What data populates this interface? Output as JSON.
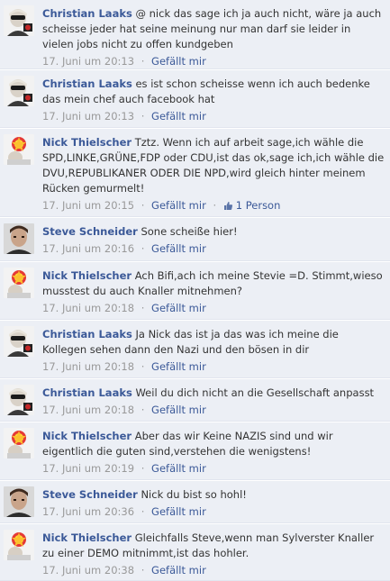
{
  "comments": [
    {
      "author": "Christian Laaks",
      "avatar": "christian-avatar",
      "text": "@ nick das sage ich ja auch nicht, wäre ja auch scheisse jeder hat seine meinung nur man darf sie leider in vielen jobs nicht zu offen kundgeben",
      "time": "17. Juni um 20:13",
      "like_label": "Gefällt mir",
      "likes": ""
    },
    {
      "author": "Christian Laaks",
      "avatar": "christian-avatar",
      "text": "es ist schon scheisse wenn ich auch bedenke das mein chef auch facebook hat",
      "time": "17. Juni um 20:13",
      "like_label": "Gefällt mir",
      "likes": ""
    },
    {
      "author": "Nick Thielscher",
      "avatar": "nick-avatar",
      "text": "Tztz. Wenn ich auf arbeit sage,ich wähle die SPD,LINKE,GRÜNE,FDP oder CDU,ist das ok,sage ich,ich wähle die DVU,REPUBLIKANER ODER DIE NPD,wird gleich hinter meinem Rücken gemurmelt!",
      "time": "17. Juni um 20:15",
      "like_label": "Gefällt mir",
      "likes": "1 Person"
    },
    {
      "author": "Steve Schneider",
      "avatar": "steve-avatar",
      "text": "Sone scheiße hier!",
      "time": "17. Juni um 20:16",
      "like_label": "Gefällt mir",
      "likes": ""
    },
    {
      "author": "Nick Thielscher",
      "avatar": "nick-avatar",
      "text": "Ach Bifi,ach ich meine Stevie =D. Stimmt,wieso musstest du auch Knaller mitnehmen?",
      "time": "17. Juni um 20:18",
      "like_label": "Gefällt mir",
      "likes": ""
    },
    {
      "author": "Christian Laaks",
      "avatar": "christian-avatar",
      "text": "Ja Nick das ist ja das was ich meine die Kollegen sehen dann den Nazi und den bösen in dir",
      "time": "17. Juni um 20:18",
      "like_label": "Gefällt mir",
      "likes": ""
    },
    {
      "author": "Christian Laaks",
      "avatar": "christian-avatar",
      "text": "Weil du dich nicht an die Gesellschaft anpasst",
      "time": "17. Juni um 20:18",
      "like_label": "Gefällt mir",
      "likes": ""
    },
    {
      "author": "Nick Thielscher",
      "avatar": "nick-avatar",
      "text": "Aber das wir Keine NAZIS sind und wir eigentlich die guten sind,verstehen die wenigstens!",
      "time": "17. Juni um 20:19",
      "like_label": "Gefällt mir",
      "likes": ""
    },
    {
      "author": "Steve Schneider",
      "avatar": "steve-avatar",
      "text": "Nick du bist so hohl!",
      "time": "17. Juni um 20:36",
      "like_label": "Gefällt mir",
      "likes": ""
    },
    {
      "author": "Nick Thielscher",
      "avatar": "nick-avatar",
      "text": "Gleichfalls Steve,wenn man Sylverster Knaller zu einer DEMO mitnimmt,ist das hohler.",
      "time": "17. Juni um 20:38",
      "like_label": "Gefällt mir",
      "likes": ""
    }
  ],
  "colors": {
    "background": "#eceff5",
    "link": "#3b5998",
    "text": "#333333",
    "meta": "#999999"
  }
}
